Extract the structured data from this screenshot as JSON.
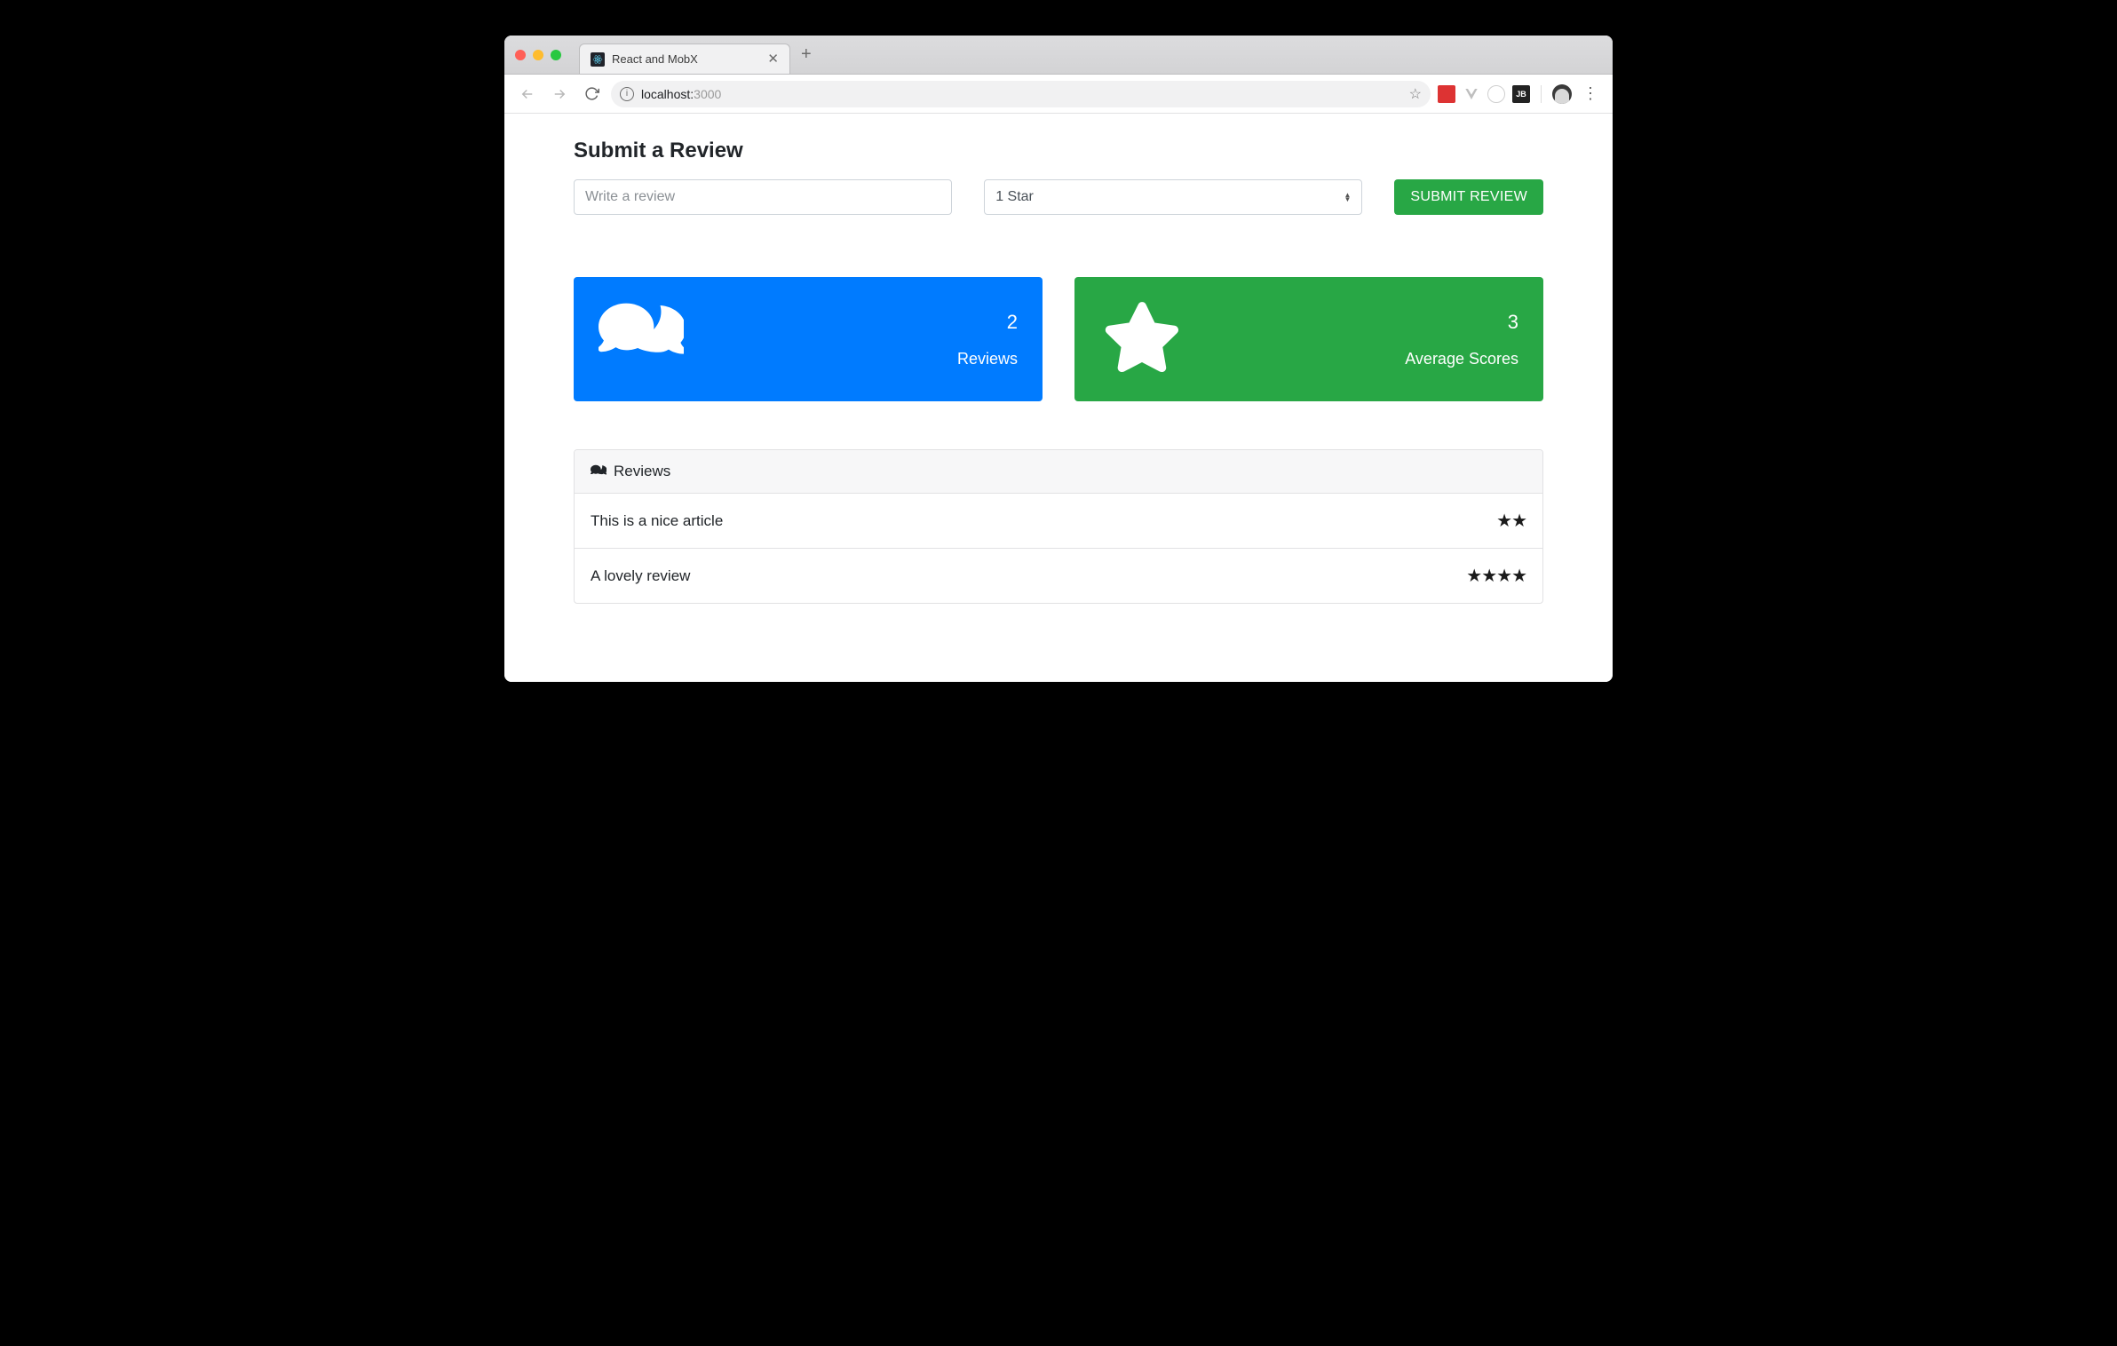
{
  "browser": {
    "tab_title": "React and MobX",
    "url_host": "localhost:",
    "url_port": "3000"
  },
  "page": {
    "heading": "Submit a Review",
    "form": {
      "review_placeholder": "Write a review",
      "star_selected": "1 Star",
      "submit_label": "SUBMIT REVIEW"
    },
    "stats": {
      "reviews": {
        "count": "2",
        "label": "Reviews"
      },
      "average": {
        "count": "3",
        "label": "Average Scores"
      }
    },
    "panel": {
      "title": "Reviews",
      "items": [
        {
          "text": "This is a nice article",
          "stars": "★★"
        },
        {
          "text": "A lovely review",
          "stars": "★★★★"
        }
      ]
    }
  }
}
